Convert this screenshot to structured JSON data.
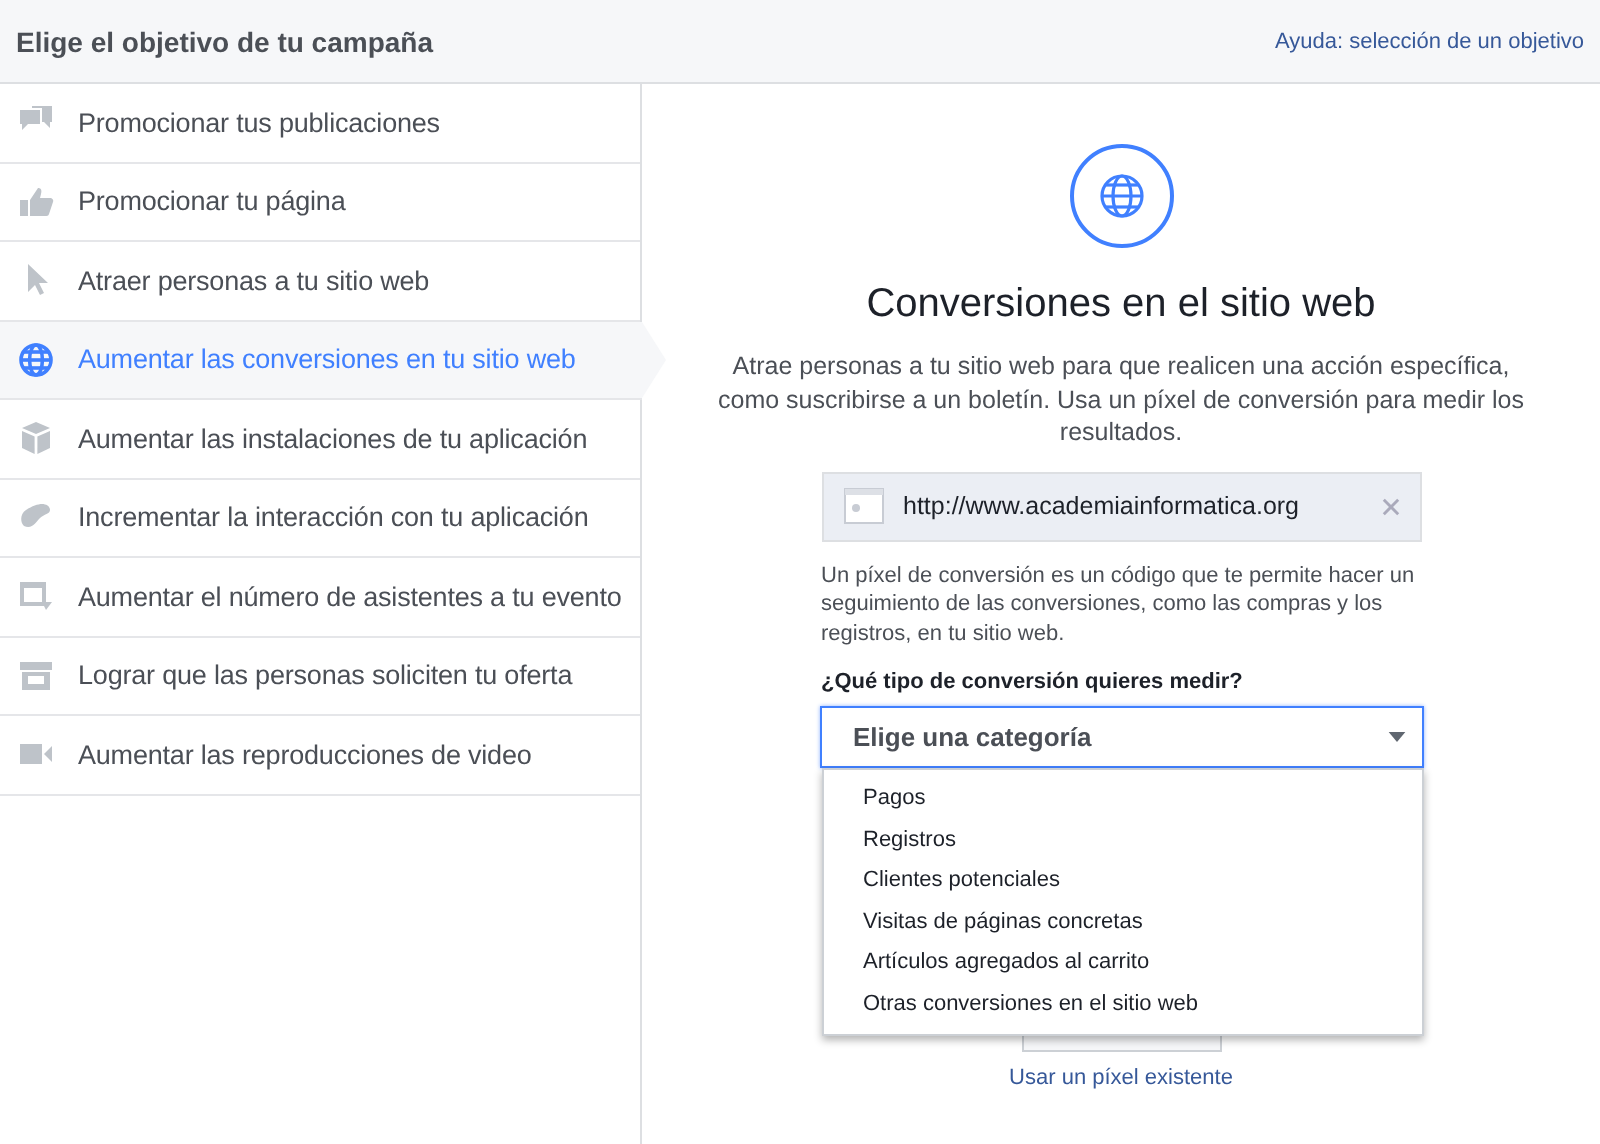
{
  "header": {
    "title": "Elige el objetivo de tu campaña",
    "help_link": "Ayuda: selección de un objetivo"
  },
  "objectives": [
    {
      "label": "Promocionar tus publicaciones",
      "selected": false
    },
    {
      "label": "Promocionar tu página",
      "selected": false
    },
    {
      "label": "Atraer personas a tu sitio web",
      "selected": false
    },
    {
      "label": "Aumentar las conversiones en tu sitio web",
      "selected": true
    },
    {
      "label": "Aumentar las instalaciones de tu aplicación",
      "selected": false
    },
    {
      "label": "Incrementar la interacción con tu aplicación",
      "selected": false
    },
    {
      "label": "Aumentar el número de asistentes a tu evento",
      "selected": false
    },
    {
      "label": "Lograr que las personas soliciten tu oferta",
      "selected": false
    },
    {
      "label": "Aumentar las reproducciones de video",
      "selected": false
    }
  ],
  "detail": {
    "title": "Conversiones en el sitio web",
    "description": "Atrae personas a tu sitio web para que realicen una acción específica, como suscribirse a un boletín. Usa un píxel de conversión para medir los resultados.",
    "url": "http://www.academiainformatica.org",
    "pixel_info": "Un píxel de conversión es un código que te permite hacer un seguimiento de las conversiones, como las compras y los registros, en tu sitio web.",
    "question": "¿Qué tipo de conversión quieres medir?",
    "dropdown": {
      "value": "Elige una categoría",
      "expanded": true,
      "options": [
        "Pagos",
        "Registros",
        "Clientes potenciales",
        "Visitas de páginas concretas",
        "Artículos agregados al carrito",
        "Otras conversiones en el sitio web"
      ]
    },
    "existing_pixel_link": "Usar un píxel existente"
  }
}
